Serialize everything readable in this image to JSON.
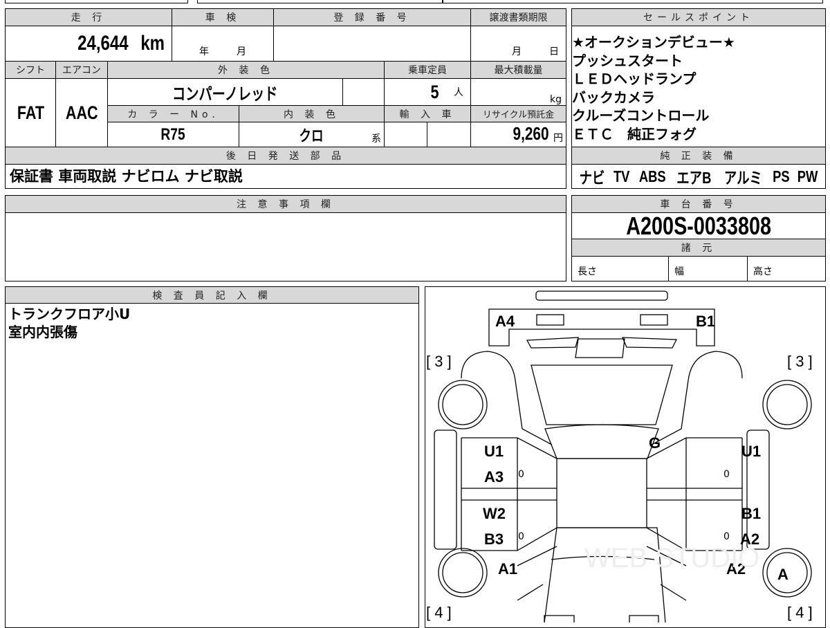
{
  "header": {
    "mileage_label": "走 行",
    "shaken_label": "車 検",
    "reg_label": "登 録 番 号",
    "transfer_label": "譲渡書類期限",
    "mileage": "24,644",
    "mileage_unit": "km",
    "year_unit": "年",
    "month_unit": "月",
    "month_unit2": "月",
    "day_unit": "日",
    "shift_label": "シフト",
    "ac_label": "エアコン",
    "ext_color_label": "外 装 色",
    "capacity_label": "乗車定員",
    "max_load_label": "最大積載量",
    "shift": "FAT",
    "ac": "AAC",
    "ext_color": "コンパーノレッド",
    "capacity": "5",
    "capacity_unit": "人",
    "load_unit": "kg",
    "color_no_label": "カ ラ ー No.",
    "int_color_label": "内 装 色",
    "import_label": "輸 入 車",
    "recycle_label": "リサイクル預託金",
    "color_no": "R75",
    "int_color": "クロ",
    "int_color_suffix": "系",
    "recycle_fee": "9,260",
    "recycle_unit": "円",
    "later_parts_label": "後 日 発 送 部 品",
    "later_parts": "保証書 車両取説 ナビロム ナビ取説"
  },
  "sales": {
    "label": "セールスポイント",
    "lines": [
      "★オークションデビュー★",
      "プッシュスタート",
      "ＬＥＤヘッドランプ",
      "バックカメラ",
      "クルーズコントロール",
      "ＥＴＣ　純正フォグ"
    ],
    "equip_label": "純 正 装 備",
    "equipment": [
      "ナビ",
      "TV",
      "ABS",
      "エアB",
      "アルミ",
      "PS",
      "PW"
    ]
  },
  "notes": {
    "label": "注 意 事 項 欄"
  },
  "chassis": {
    "label": "車 台 番 号",
    "number": "A200S-0033808",
    "spec_label": "諸 元",
    "length": "長さ",
    "width": "幅",
    "height": "高さ"
  },
  "inspector": {
    "label": "検 査 員 記 入 欄",
    "lines": [
      "トランクフロア小U",
      "室内内張傷"
    ]
  },
  "diagram": {
    "marks": {
      "a4": "A4",
      "b1_top": "B1",
      "g": "G",
      "u1_l": "U1",
      "a3": "A3",
      "w2": "W2",
      "b3": "B3",
      "a1": "A1",
      "u1_r": "U1",
      "b1_r": "B1",
      "a2_r": "A2",
      "a2_w": "A2",
      "a_wheel": "A",
      "tl": "[ 3 ]",
      "tr": "[ 3 ]",
      "bl": "[ 4 ]",
      "br": "[ 4 ]"
    },
    "small_zeros": [
      "0",
      "0",
      "0",
      "0"
    ],
    "watermark": "WEB STUDIO"
  }
}
